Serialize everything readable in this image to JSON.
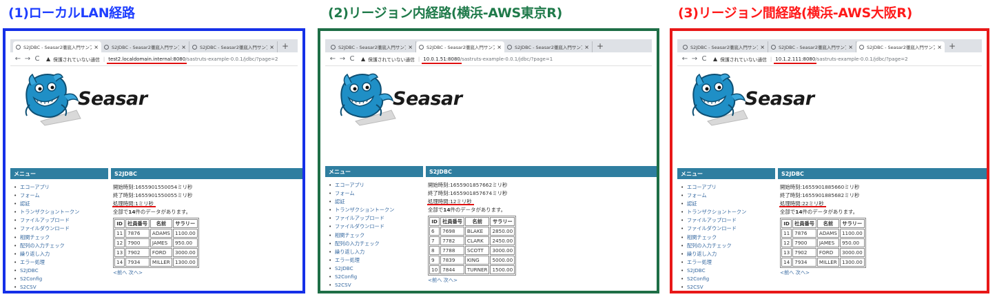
{
  "common": {
    "tab_title": "S2JDBC - Seasar2徹底入門サンプ",
    "new_tab": "+",
    "security_label": "保護されていない通信",
    "brand": "Seasar",
    "menu_header": "メニュー",
    "main_header": "S2JDBC",
    "nav": {
      "back": "←",
      "forward": "→",
      "reload": "C",
      "warning": "▲",
      "separator": "|"
    },
    "menu_items": [
      "エコーアプリ",
      "フォーム",
      "認証",
      "トランザクショントークン",
      "ファイルアップロード",
      "ファイルダウンロード",
      "相関チェック",
      "配列の入力チェック",
      "繰り返し入力",
      "エラー処理",
      "S2JDBC",
      "S2Config",
      "S2CSV"
    ],
    "summary_prefix": "全部で",
    "summary_count": "14",
    "summary_suffix": "件のデータがあります。",
    "table_headers": [
      "ID",
      "社員番号",
      "名前",
      "サラリー"
    ],
    "pager": "<前へ 次へ>",
    "start_label": "開始時刻:",
    "end_label": "終了時刻:",
    "proc_label": "処理時間:",
    "ms_unit": "ミリ秒"
  },
  "panels": [
    {
      "caption": "(1)ローカルLAN経路",
      "caption_color": "#1f3fff",
      "border_color": "#1530e8",
      "active_tab": 0,
      "host": "test2.localdomain.internal:8080",
      "path": "/sastruts-example-0.0.1/jdbc/?page=2",
      "start": "1655901550054",
      "end": "1655901550055",
      "proc": "1",
      "rows": [
        [
          "11",
          "7876",
          "ADAMS",
          "1100.00"
        ],
        [
          "12",
          "7900",
          "JAMES",
          "950.00"
        ],
        [
          "13",
          "7902",
          "FORD",
          "3000.00"
        ],
        [
          "14",
          "7934",
          "MILLER",
          "1300.00"
        ]
      ]
    },
    {
      "caption": "(2)リージョン内経路(横浜-AWS東京R)",
      "caption_color": "#1f7a4a",
      "border_color": "#1e6e46",
      "active_tab": 1,
      "host": "10.0.1.51:8080",
      "path": "/sastruts-example-0.0.1/jdbc/?page=1",
      "start": "1655901857662",
      "end": "1655901857674",
      "proc": "12",
      "rows": [
        [
          "6",
          "7698",
          "BLAKE",
          "2850.00"
        ],
        [
          "7",
          "7782",
          "CLARK",
          "2450.00"
        ],
        [
          "8",
          "7788",
          "SCOTT",
          "3000.00"
        ],
        [
          "9",
          "7839",
          "KING",
          "5000.00"
        ],
        [
          "10",
          "7844",
          "TURNER",
          "1500.00"
        ]
      ]
    },
    {
      "caption": "(3)リージョン間経路(横浜-AWS大阪R)",
      "caption_color": "#ff1a1a",
      "border_color": "#e81818",
      "active_tab": 2,
      "host": "10.1.2.111:8080",
      "path": "/sastruts-example-0.0.1/jdbc/?page=2",
      "start": "1655901885660",
      "end": "1655901885682",
      "proc": "22",
      "rows": [
        [
          "11",
          "7876",
          "ADAMS",
          "1100.00"
        ],
        [
          "12",
          "7900",
          "JAMES",
          "950.00"
        ],
        [
          "13",
          "7902",
          "FORD",
          "3000.00"
        ],
        [
          "14",
          "7934",
          "MILLER",
          "1300.00"
        ]
      ]
    }
  ]
}
